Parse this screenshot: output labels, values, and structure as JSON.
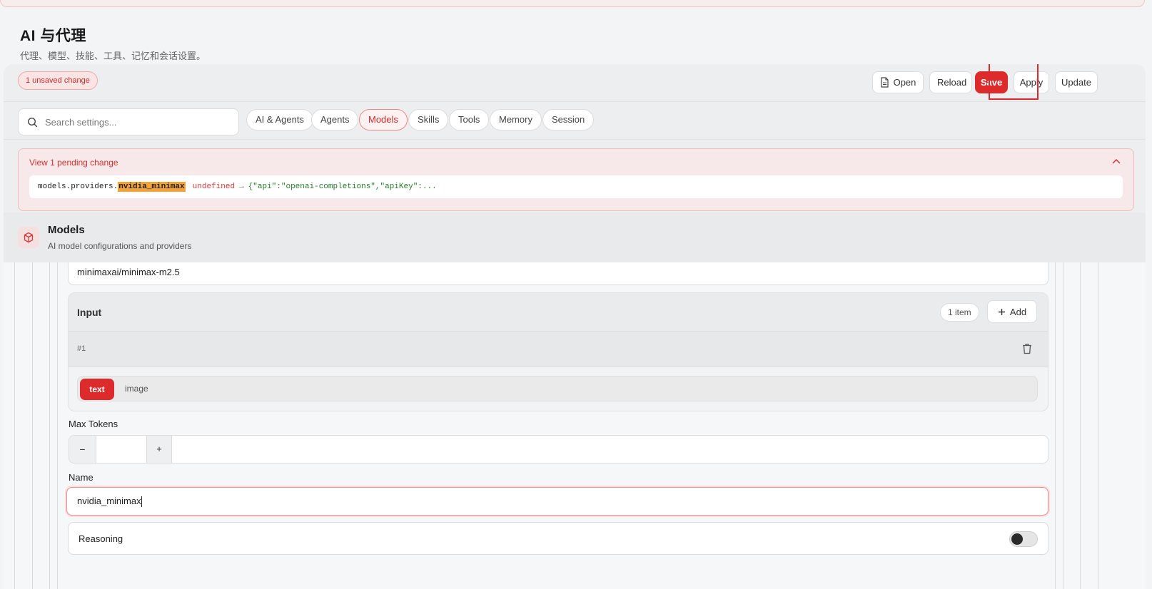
{
  "page": {
    "title": "AI 与代理",
    "subtitle": "代理、模型、技能、工具、记忆和会话设置。"
  },
  "toolbar": {
    "unsaved_badge": "1 unsaved change",
    "open_label": "Open",
    "reload_label": "Reload",
    "save_label": "Save",
    "apply_label": "Apply",
    "update_label": "Update"
  },
  "search": {
    "placeholder": "Search settings..."
  },
  "filters": [
    {
      "label": "AI & Agents",
      "active": false
    },
    {
      "label": "Agents",
      "active": false
    },
    {
      "label": "Models",
      "active": true
    },
    {
      "label": "Skills",
      "active": false
    },
    {
      "label": "Tools",
      "active": false
    },
    {
      "label": "Memory",
      "active": false
    },
    {
      "label": "Session",
      "active": false
    }
  ],
  "pending": {
    "title": "View 1 pending change",
    "path_prefix": "models.providers.",
    "path_key": "nvidia_minimax",
    "old_value": "undefined",
    "arrow": "→",
    "new_value": "{\"api\":\"openai-completions\",\"apiKey\":..."
  },
  "section": {
    "title": "Models",
    "subtitle": "AI model configurations and providers"
  },
  "model_id_value": "minimaxai/minimax-m2.5",
  "input_list": {
    "title": "Input",
    "count": "1 item",
    "add_label": "Add",
    "row_number": "#1",
    "options": [
      "text",
      "image"
    ],
    "selected": "text"
  },
  "max_tokens": {
    "label": "Max Tokens",
    "minus": "−",
    "plus": "+",
    "value": ""
  },
  "name_field": {
    "label": "Name",
    "value": "nvidia_minimax"
  },
  "reasoning": {
    "label": "Reasoning",
    "enabled": false
  },
  "colors": {
    "accent": "#dd2a2a",
    "highlight": "#f4a23a"
  }
}
